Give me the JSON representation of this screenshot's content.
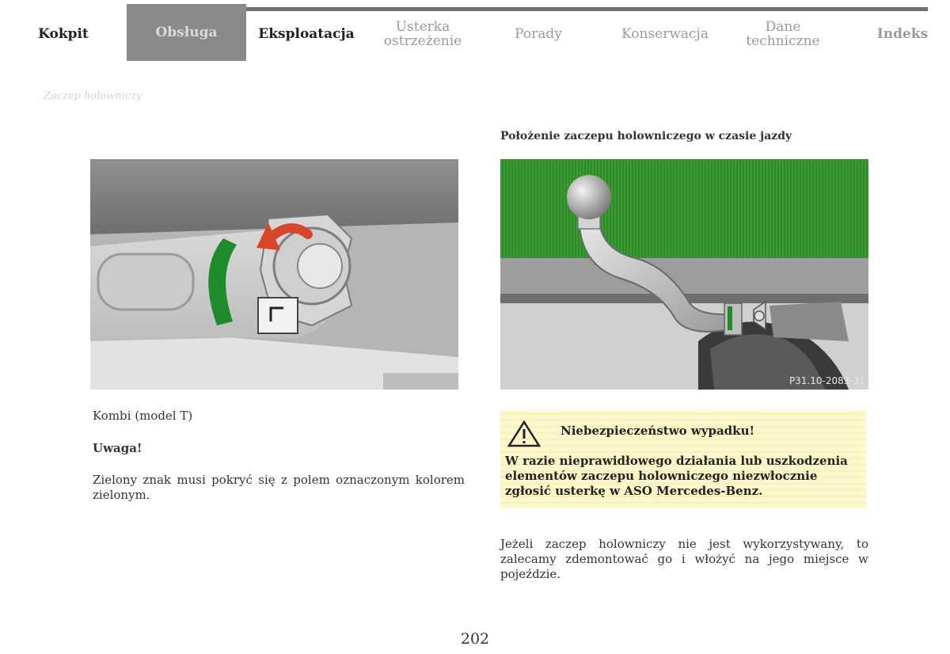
{
  "nav": {
    "tabs": [
      {
        "label": "Kokpit"
      },
      {
        "label": "Obsługa"
      },
      {
        "label": "Eksploatacja"
      },
      {
        "label": "Usterka ostrzeżenie"
      },
      {
        "label": "Porady"
      },
      {
        "label": "Konserwacja"
      },
      {
        "label": "Dane techniczne"
      },
      {
        "label": "Indeks"
      }
    ],
    "active_index": 1
  },
  "breadcrumb": "Zaczep holowniczy",
  "left": {
    "caption": "Kombi (model T)",
    "note_title": "Uwaga!",
    "note_text": "Zielony znak musi pokryć się z polem oznaczonym kolorem zielonym."
  },
  "right": {
    "heading": "Położenie zaczepu holowniczego w czasie jazdy",
    "photo_code": "P31.10-2083-31",
    "warning": {
      "title": "Niebezpieczeństwo wypadku!",
      "text": "W razie nieprawidłowego działania lub uszkodzenia elementów zaczepu holowniczego niezwłocznie zgłosić usterkę w ASO Mercedes-Benz."
    },
    "paragraph": "Jeżeli zaczep holowniczy nie jest wykorzystywany, to zalecamy zdemontować go i włożyć na jego miejsce w pojeździe."
  },
  "page_number": "202",
  "colors": {
    "green": "#1e8c2d",
    "red": "#d8462a",
    "warning_bg": "#fdf7cf"
  }
}
